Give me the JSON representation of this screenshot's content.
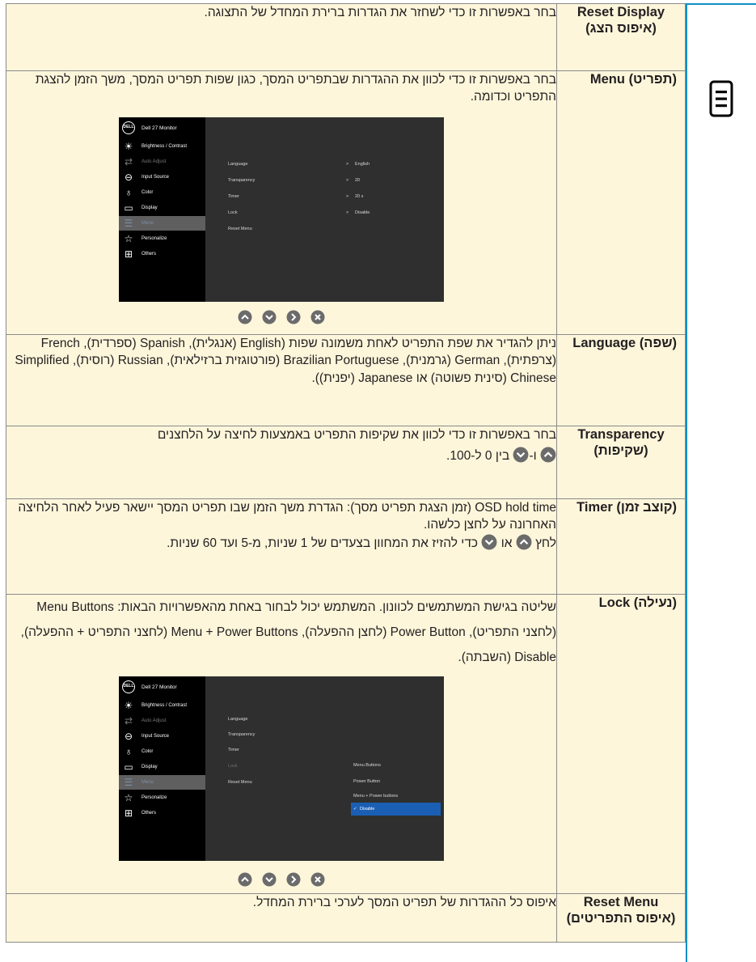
{
  "rows": [
    {
      "label_en": "Reset Display",
      "label_he": "(איפוס הצג)",
      "desc": "בחר באפשרות זו כדי לשחזר את הגדרות ברירת המחדל של התצוגה."
    },
    {
      "label_en": "Menu",
      "label_he": "(תפריט)",
      "desc": "בחר באפשרות זו כדי לכוון את ההגדרות שבתפריט המסך, כגון שפות תפריט המסך, משך הזמן להצגת התפריט וכדומה."
    },
    {
      "label_en": "Language",
      "label_he": "(שפה)",
      "desc": "ניתן להגדיר את שפת התפריט לאחת משמונה שפות (English (אנגלית), Spanish (ספרדית), French (צרפתית), German (גרמנית), Brazilian Portuguese (פורטוגזית ברזילאית), Russian (רוסית), Simplified Chinese (סינית פשוטה) או Japanese (יפנית))."
    },
    {
      "label_en": "Transparency",
      "label_he": "(שקיפות)",
      "desc_line1": "בחר באפשרות זו כדי לכוון את שקיפות התפריט באמצעות לחיצה על הלחצנים",
      "desc_join": "ו-",
      "desc_end": "בין 0 ל-100."
    },
    {
      "label_en": "Timer",
      "label_he": "(קוצב זמן)",
      "desc_p1": "OSD hold time (זמן הצגת תפריט מסך): הגדרת משך הזמן שבו תפריט המסך יישאר פעיל לאחר הלחיצה האחרונה על לחצן כלשהו.",
      "desc_p2_start": "לחץ",
      "desc_p2_or": "או",
      "desc_p2_end": "כדי להזיז את המחוון בצעדים של 1 שניות, מ-5 ועד 60 שניות."
    },
    {
      "label_en": "Lock",
      "label_he": "(נעילה)",
      "desc": "שליטה בגישת המשתמשים לכוונון. המשתמש יכול לבחור באחת מהאפשרויות הבאות: Menu Buttons (לחצני התפריט), Power Button (לחצן ההפעלה), Menu + Power Buttons (לחצני התפריט + ההפעלה), Disable (השבתה)."
    },
    {
      "label_en": "Reset Menu",
      "label_he": "(איפוס התפריטים)",
      "desc": "איפוס כל ההגדרות של תפריט המסך לערכי ברירת המחדל."
    }
  ],
  "osd": {
    "logo": "DELL",
    "title": "Dell 27 Monitor",
    "menu": [
      {
        "label": "Brightness / Contrast",
        "icon": "brightness-icon"
      },
      {
        "label": "Auto Adjust",
        "icon": "auto-adjust-icon"
      },
      {
        "label": "Input Source",
        "icon": "input-source-icon"
      },
      {
        "label": "Color",
        "icon": "color-icon"
      },
      {
        "label": "Display",
        "icon": "display-icon"
      },
      {
        "label": "Menu",
        "icon": "menu-icon"
      },
      {
        "label": "Personalize",
        "icon": "star-icon"
      },
      {
        "label": "Others",
        "icon": "others-icon"
      }
    ],
    "submenu_labels": [
      "Language",
      "Transparency",
      "Timer",
      "Lock",
      "Reset Menu"
    ],
    "arrow": ">",
    "submenu_values": [
      "English",
      "20",
      "20 s",
      "Disable"
    ],
    "lock_options": [
      "Menu Buttons",
      "Power Button",
      "Menu + Power buttons",
      "Disable"
    ],
    "selected_lock_option": "Disable"
  },
  "colors": {
    "row_bg": "#fdf6db",
    "border": "#8a8a8a",
    "accent_blue": "#0e8fc7",
    "osd_left_bg": "#000000",
    "osd_right_bg": "#2f2f2f",
    "osd_selected_bg": "#5f5f5f",
    "osd_highlight": "#1a5fb4",
    "button_grey": "#6b6b6b"
  }
}
